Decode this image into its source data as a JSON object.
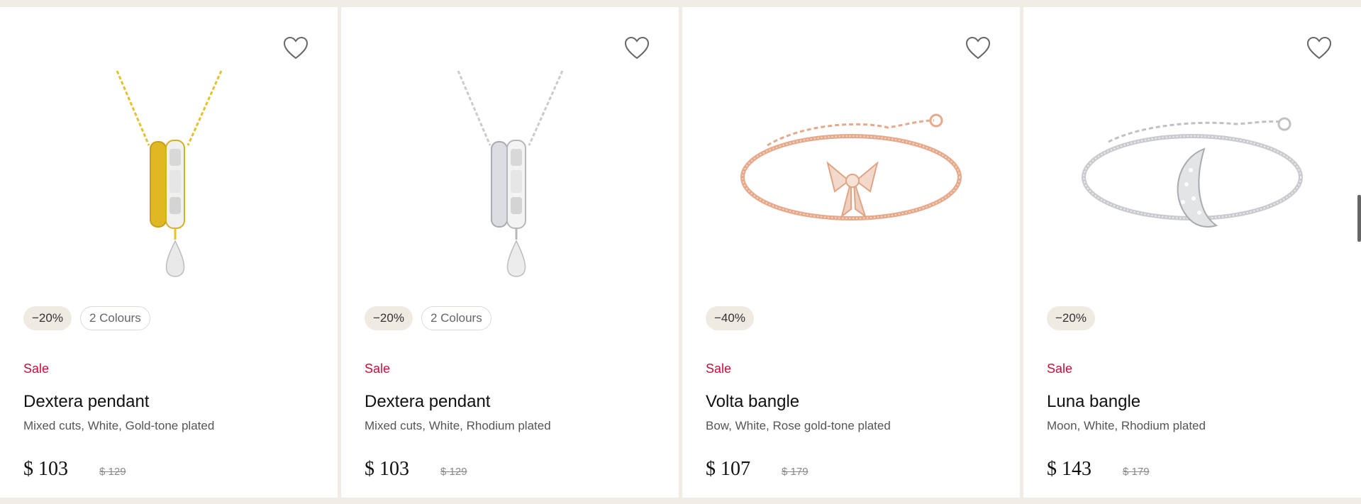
{
  "products": [
    {
      "discount": "−20%",
      "colours": "2 Colours",
      "sale_label": "Sale",
      "name": "Dextera pendant",
      "description": "Mixed cuts, White, Gold-tone plated",
      "price": "$ 103",
      "old_price": "$ 129",
      "image": "gold-pendant-image",
      "metal_color": "#e5c12a"
    },
    {
      "discount": "−20%",
      "colours": "2 Colours",
      "sale_label": "Sale",
      "name": "Dextera pendant",
      "description": "Mixed cuts, White, Rhodium plated",
      "price": "$ 103",
      "old_price": "$ 129",
      "image": "silver-pendant-image",
      "metal_color": "#c9cbcf"
    },
    {
      "discount": "−40%",
      "sale_label": "Sale",
      "name": "Volta bangle",
      "description": "Bow, White, Rose gold-tone plated",
      "price": "$ 107",
      "old_price": "$ 179",
      "image": "rose-gold-bow-bangle-image",
      "metal_color": "#e5a98b"
    },
    {
      "discount": "−20%",
      "sale_label": "Sale",
      "name": "Luna bangle",
      "description": "Moon, White, Rhodium plated",
      "price": "$ 143",
      "old_price": "$ 179",
      "image": "silver-moon-bangle-image",
      "metal_color": "#c9cbcf"
    }
  ],
  "icons": {
    "wishlist": "heart-outline-icon"
  },
  "colors": {
    "sale": "#c4103b",
    "background": "#efede6",
    "badge": "#efeae2"
  }
}
